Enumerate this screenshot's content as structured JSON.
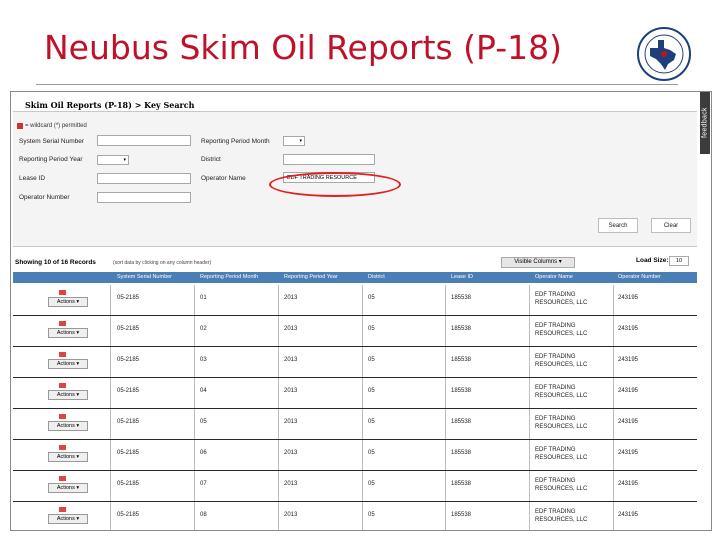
{
  "slide": {
    "title": "Neubus Skim Oil Reports (P-18)"
  },
  "app": {
    "breadcrumb": "Skim Oil Reports (P-18) > Key Search",
    "feedback_label": "feedback",
    "wildcard_note": "= wildcard (*) permitted"
  },
  "search": {
    "labels": {
      "system_serial": "System Serial Number",
      "period_year": "Reporting Period Year",
      "lease_id": "Lease ID",
      "operator_number": "Operator Number",
      "period_month": "Reporting Period Month",
      "district": "District",
      "operator_name": "Operator Name"
    },
    "values": {
      "system_serial": "",
      "period_year": "",
      "lease_id": "",
      "operator_number": "",
      "period_month": "",
      "district": "",
      "operator_name": "EDF TRADING RESOURCE"
    },
    "buttons": {
      "search": "Search",
      "clear": "Clear"
    }
  },
  "results": {
    "showing": "Showing 10 of 16 Records",
    "sort_note": "(sort data by clicking on any column header)",
    "visible_columns_label": "Visible Columns",
    "load_size_label": "Load Size:",
    "load_size_value": "10",
    "columns": [
      "System Serial Number",
      "Reporting Period Month",
      "Reporting Period Year",
      "District",
      "Lease ID",
      "Operator Name",
      "Operator Number"
    ],
    "actions_label": "Actions",
    "rows": [
      {
        "serial": "05-2185",
        "month": "01",
        "year": "2013",
        "district": "05",
        "lease": "185538",
        "operator": "EDF TRADING RESOURCES, LLC",
        "opnum": "243195"
      },
      {
        "serial": "05-2185",
        "month": "02",
        "year": "2013",
        "district": "05",
        "lease": "185538",
        "operator": "EDF TRADING RESOURCES, LLC",
        "opnum": "243195"
      },
      {
        "serial": "05-2185",
        "month": "03",
        "year": "2013",
        "district": "05",
        "lease": "185538",
        "operator": "EDF TRADING RESOURCES, LLC",
        "opnum": "243195"
      },
      {
        "serial": "05-2185",
        "month": "04",
        "year": "2013",
        "district": "05",
        "lease": "185538",
        "operator": "EDF TRADING RESOURCES, LLC",
        "opnum": "243195"
      },
      {
        "serial": "05-2185",
        "month": "05",
        "year": "2013",
        "district": "05",
        "lease": "185538",
        "operator": "EDF TRADING RESOURCES, LLC",
        "opnum": "243195"
      },
      {
        "serial": "05-2185",
        "month": "06",
        "year": "2013",
        "district": "05",
        "lease": "185538",
        "operator": "EDF TRADING RESOURCES, LLC",
        "opnum": "243195"
      },
      {
        "serial": "05-2185",
        "month": "07",
        "year": "2013",
        "district": "05",
        "lease": "185538",
        "operator": "EDF TRADING RESOURCES, LLC",
        "opnum": "243195"
      },
      {
        "serial": "05-2185",
        "month": "08",
        "year": "2013",
        "district": "05",
        "lease": "185538",
        "operator": "EDF TRADING RESOURCES, LLC",
        "opnum": "243195"
      }
    ]
  },
  "colors": {
    "title": "#c0112a",
    "table_header": "#4a7fb5",
    "highlight": "#e02020",
    "seal": "#1f3f7a"
  }
}
